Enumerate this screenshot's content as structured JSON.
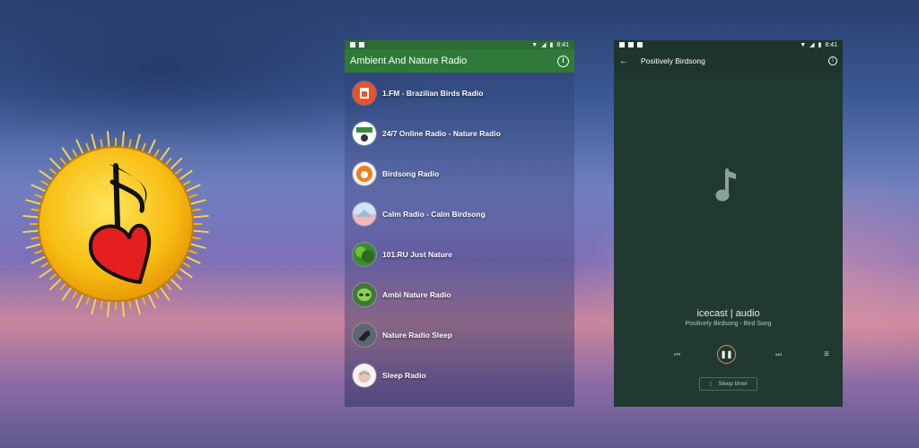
{
  "logo": {
    "icon": "music-note-heart-sun-icon",
    "colors": {
      "sun": "#f5b50a",
      "heart": "#e02020",
      "note": "#111111"
    }
  },
  "status_bar": {
    "time": "8:41"
  },
  "station_list_screen": {
    "title": "Ambient And Nature Radio",
    "accent": "#2f7a38",
    "stations": [
      {
        "name": "1.FM - Brazilian Birds Radio",
        "icon": "1fm-logo-icon"
      },
      {
        "name": "24/7 Online Radio - Nature Radio",
        "icon": "nature-radio-logo-icon"
      },
      {
        "name": "Birdsong Radio",
        "icon": "birdsong-logo-icon"
      },
      {
        "name": "Calm Radio - Calm Birdsong",
        "icon": "calm-radio-logo-icon"
      },
      {
        "name": "101.RU Just Nature",
        "icon": "just-nature-logo-icon"
      },
      {
        "name": "Ambi Nature Radio",
        "icon": "ambi-alien-logo-icon"
      },
      {
        "name": "Nature Radio Sleep",
        "icon": "bird-photo-icon"
      },
      {
        "name": "Sleep Radio",
        "icon": "sleep-radio-logo-icon"
      }
    ]
  },
  "player_screen": {
    "title": "Positively Birdsong",
    "stream_title": "icecast | audio",
    "stream_subtitle": "Positively Birdsong - Bird Song",
    "sleep_timer_label": "Sleep timer",
    "accent": "#e38a5d",
    "background": "#213a31"
  }
}
